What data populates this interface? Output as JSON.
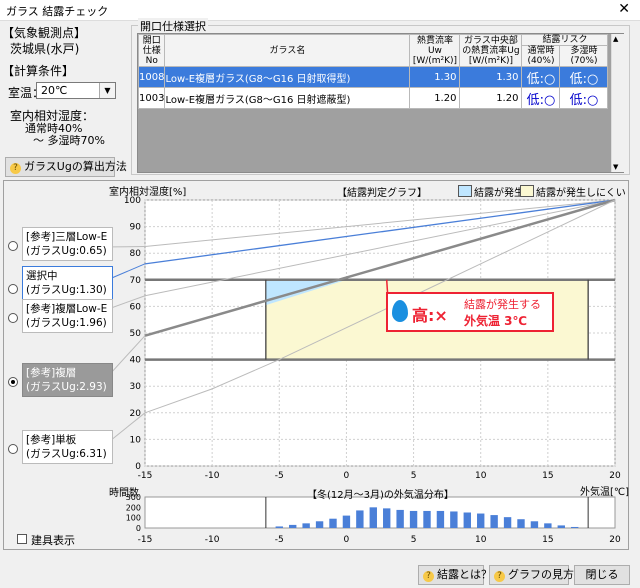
{
  "window": {
    "title": "ガラス 結露チェック",
    "close_glyph": "✕"
  },
  "left": {
    "station_header": "【気象観測点】",
    "station_value": "茨城県(水戸)",
    "calc_header": "【計算条件】",
    "room_temp_label": "室温：",
    "room_temp_value": "20℃",
    "humidity_header": "室内相対湿度：",
    "humidity_normal": "通常時40%",
    "humidity_range": "〜 多湿時70%",
    "ug_button": "ガラスUgの算出方法"
  },
  "opening": {
    "group_title": "開口仕様選択",
    "headers": {
      "no": "開口\n仕様\nNo",
      "name": "ガラス名",
      "uw": "熱貫流率\nUw\n[W/(m²K)]",
      "ug": "ガラス中央部\nの熱貫流率Ug\n[W/(m²K)]",
      "risk": "結露リスク",
      "risk_normal": "通常時\n(40%)",
      "risk_humid": "多湿時\n(70%)"
    },
    "rows": [
      {
        "no": "1008",
        "name": "Low-E複層ガラス(G8〜G16 日射取得型)",
        "uw": "1.30",
        "ug": "1.30",
        "risk_normal": "低:○",
        "risk_humid": "低:○",
        "selected": true
      },
      {
        "no": "1003",
        "name": "Low-E複層ガラス(G8〜G16 日射遮蔽型)",
        "uw": "1.20",
        "ug": "1.20",
        "risk_normal": "低:○",
        "risk_humid": "低:○",
        "selected": false
      }
    ]
  },
  "chart_data": {
    "type": "line",
    "title": "【結露判定グラフ】",
    "ylabel": "室内相対湿度[%]",
    "xlabel": "外気温[℃]",
    "xlim": [
      -15,
      20
    ],
    "ylim": [
      0,
      100
    ],
    "x_ticks": [
      -15,
      -10,
      -5,
      0,
      5,
      10,
      15,
      20
    ],
    "y_ticks": [
      0,
      10,
      20,
      30,
      40,
      50,
      60,
      70,
      80,
      90,
      100
    ],
    "legend": [
      {
        "label": "結露が発生",
        "color": "#bfe6ff"
      },
      {
        "label": "結露が発生しにくい",
        "color": "#fbf8d2"
      }
    ],
    "series": [
      {
        "key": "triple",
        "points": [
          [
            -15,
            82.5
          ],
          [
            20,
            100
          ]
        ]
      },
      {
        "key": "selected",
        "points": [
          [
            -15,
            76
          ],
          [
            20,
            100
          ]
        ]
      },
      {
        "key": "double_lowe",
        "points": [
          [
            -15,
            64
          ],
          [
            20,
            100
          ]
        ]
      },
      {
        "key": "double",
        "points": [
          [
            -15,
            49
          ],
          [
            20,
            100
          ]
        ]
      },
      {
        "key": "single",
        "points": [
          [
            -15,
            20
          ],
          [
            -10,
            29
          ],
          [
            -5,
            40
          ],
          [
            0,
            52
          ],
          [
            5,
            64
          ],
          [
            10,
            76
          ],
          [
            15,
            88
          ],
          [
            20,
            100
          ]
        ]
      }
    ],
    "winter_temp_range": [
      -6,
      18
    ],
    "humidity_levels": [
      40,
      70
    ],
    "condensation_zone": {
      "x": [
        -6,
        0
      ],
      "y": [
        70,
        60.5
      ]
    },
    "annotation": {
      "grade": "高:×",
      "text": "結露が発生する",
      "temp": "外気温 3℃",
      "at": [
        3,
        70
      ]
    },
    "histogram": {
      "title": "【冬(12月〜3月)の外気温分布】",
      "ylabel": "時間数",
      "ylim": [
        0,
        300
      ],
      "y_ticks": [
        0,
        100,
        200,
        300
      ],
      "x": [
        -5,
        -4,
        -3,
        -2,
        -1,
        0,
        1,
        2,
        3,
        4,
        5,
        6,
        7,
        8,
        9,
        10,
        11,
        12,
        13,
        14,
        15,
        16,
        17
      ],
      "values": [
        15,
        30,
        45,
        65,
        90,
        120,
        170,
        200,
        190,
        175,
        165,
        165,
        165,
        160,
        150,
        140,
        125,
        105,
        85,
        65,
        45,
        25,
        10
      ]
    }
  },
  "options": [
    {
      "line1": "[参考]三層Low-E",
      "line2": "(ガラスUg:0.65)",
      "checked": false
    },
    {
      "line1": "選択中",
      "line2": "(ガラスUg:1.30)",
      "checked": false
    },
    {
      "line1": "[参考]複層Low-E",
      "line2": "(ガラスUg:1.96)",
      "checked": false
    },
    {
      "line1": "[参考]複層",
      "line2": "(ガラスUg:2.93)",
      "checked": true
    },
    {
      "line1": "[参考]単板",
      "line2": "(ガラスUg:6.31)",
      "checked": false
    }
  ],
  "fixture_label": "建具表示",
  "footer": {
    "help_condensation": "結露とは？",
    "help_graph": "グラフの見方",
    "close": "閉じる"
  }
}
